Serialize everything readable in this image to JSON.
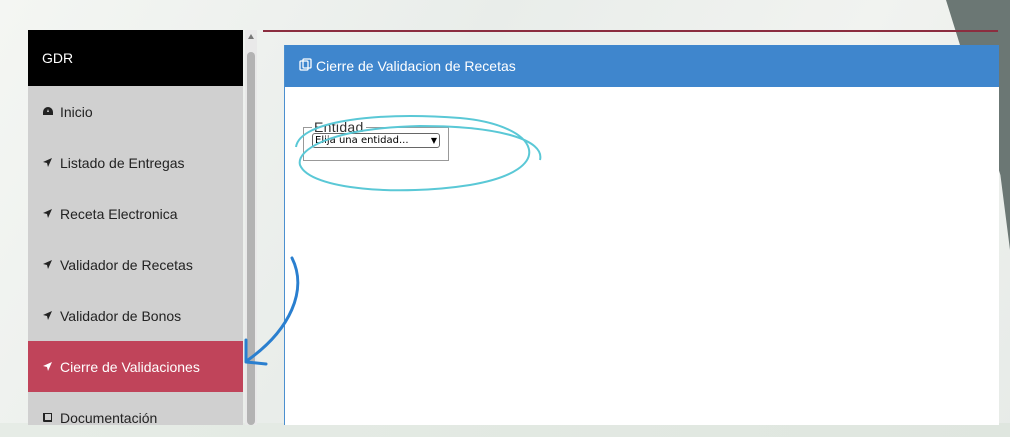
{
  "sidebar": {
    "title": "GDR",
    "items": [
      {
        "label": "Inicio",
        "icon": "dashboard-icon"
      },
      {
        "label": "Listado de Entregas",
        "icon": "arrow-icon"
      },
      {
        "label": "Receta Electronica",
        "icon": "arrow-icon"
      },
      {
        "label": "Validador de Recetas",
        "icon": "arrow-icon"
      },
      {
        "label": "Validador de Bonos",
        "icon": "arrow-icon"
      },
      {
        "label": "Cierre de Validaciones",
        "icon": "arrow-icon",
        "active": true
      },
      {
        "label": "Documentación",
        "icon": "book-icon"
      }
    ]
  },
  "panel": {
    "title": "Cierre de Validacion de Recetas",
    "icon": "copy-icon"
  },
  "entity": {
    "legend": "Entidad",
    "selected": "Elija una entidad..."
  },
  "colors": {
    "active": "#c0445a",
    "header": "#3f86cd",
    "annotation": "#5ac8d6",
    "arrow": "#2a7fcf"
  }
}
